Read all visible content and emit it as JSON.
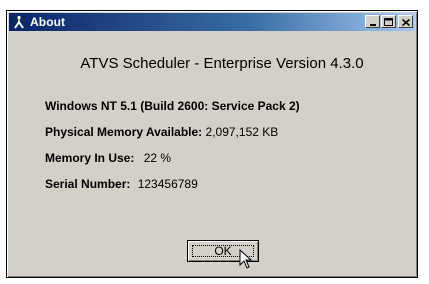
{
  "window": {
    "title": "About",
    "icon": "app-icon",
    "buttons": [
      "minimize-icon",
      "maximize-icon",
      "close-icon"
    ]
  },
  "heading": "ATVS Scheduler - Enterprise Version 4.3.0",
  "info": {
    "os": "Windows NT 5.1 (Build 2600: Service Pack 2)",
    "physical_memory_label": "Physical Memory Available:",
    "physical_memory_value": "2,097,152 KB",
    "memory_in_use_label": "Memory In Use:",
    "memory_in_use_value": "22 %",
    "serial_label": "Serial Number:",
    "serial_value": "123456789"
  },
  "ok_button": {
    "label": "OK"
  },
  "colors": {
    "titlebar_start": "#0a246a",
    "titlebar_end": "#a6caf0",
    "face": "#d4d0c8"
  }
}
